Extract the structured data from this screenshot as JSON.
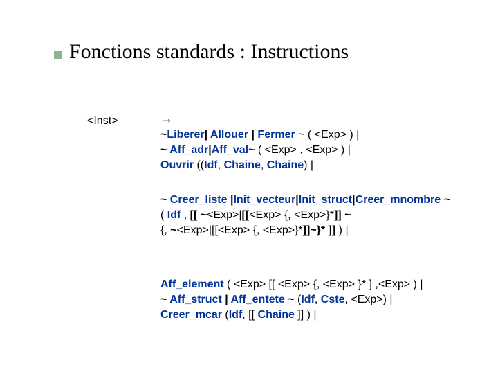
{
  "title": "Fonctions standards : Instructions",
  "rule": {
    "name": "<Inst>",
    "arrow": "→"
  },
  "b1": {
    "s1": "~",
    "s2": "Liberer",
    "s3": "| ",
    "s4": "Allouer",
    "s5": " | ",
    "s6": "",
    "s7": "Fermer",
    "s8": " ~ ( <Exp> )  |",
    "s9": "~ ",
    "s10": "Aff_adr",
    "s11": "|",
    "s12": "",
    "s13": "Aff_val",
    "s14": "~  ( <Exp>  , ",
    "s15": "",
    "s16": "<Exp> )  |",
    "s17": "Ouvrir ",
    "s18": "((",
    "s19": "Idf",
    "s20": ", ",
    "s21": "Chaine",
    "s22": ", ",
    "s23": "Chaine",
    "s24": ")  |"
  },
  "b2": {
    "s1": "~ ",
    "s2": "Creer_liste ",
    "s3": " |",
    "s4": "Init_vecteur",
    "s5": "|",
    "s6": "Init_struct",
    "s7": "|",
    "s8": "Creer_mnombre",
    "s9": " ~",
    "s10": "( ",
    "s11": "Idf",
    "s12": " , ",
    "s13": "[[ ",
    "s14": " ",
    "s15": "~",
    "s16": "<Exp>",
    "s17": "",
    "s18": "|",
    "s19": "",
    "s20": "[[",
    "s21": "<Exp> {, <Exp>}*",
    "s22": "]] ~",
    "s23": "{, ",
    "s24": "~",
    "s25": "",
    "s26": "",
    "s27": "<Exp>",
    "s28": "",
    "s29": "|",
    "s30": "",
    "s31": "[[<Exp> {, <Exp>}*",
    "s32": "]]",
    "s33": "",
    "s34": "~}*  ]]",
    "s35": " )  |"
  },
  "b3": {
    "sp": " ",
    "s1": "Aff_element",
    "s2": " ( <Exp> ",
    "s3": "",
    "s4": "[[ <Exp> {, ",
    "s5": "",
    "s6": "<Exp> ",
    "s7": "",
    "s8": " }* ] ,",
    "s9": "",
    "s10": "<Exp> )  |",
    "s11": "~ ",
    "s12": "Aff_struct",
    "s13": " | ",
    "s14": "Aff_entete",
    "s15": " ~",
    "s16": " (",
    "s17": "Idf",
    "s18": ", ",
    "s19": "Cste",
    "s20": ", <Exp>",
    "s21": "",
    "s22": ")  |",
    "s23": "Creer_mcar",
    "s24": " (",
    "s25": "Idf",
    "s26": ", [[ ",
    "s27": "Chaine",
    "s28": " ]] )  |"
  }
}
